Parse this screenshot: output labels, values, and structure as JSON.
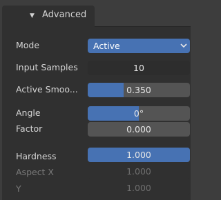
{
  "panel": {
    "title": "Advanced",
    "rows": {
      "mode": {
        "label": "Mode",
        "value": "Active"
      },
      "input_samples": {
        "label": "Input Samples",
        "value": "10"
      },
      "active_smooth": {
        "label": "Active Smoo...",
        "value": "0.350",
        "fill": 0.35
      },
      "angle": {
        "label": "Angle",
        "value": "0°",
        "fill": 0.5
      },
      "factor": {
        "label": "Factor",
        "value": "0.000"
      },
      "hardness": {
        "label": "Hardness",
        "value": "1.000",
        "fill": 1.0
      },
      "aspect_x": {
        "label": "Aspect X",
        "value": "1.000"
      },
      "y": {
        "label": "Y",
        "value": "1.000"
      }
    }
  },
  "colors": {
    "accent": "#4772b3",
    "panel_bg": "#303030",
    "field_bg": "#545454"
  },
  "icons": {
    "collapse": "disclosure-triangle-down",
    "dropdown": "chevron-down"
  }
}
